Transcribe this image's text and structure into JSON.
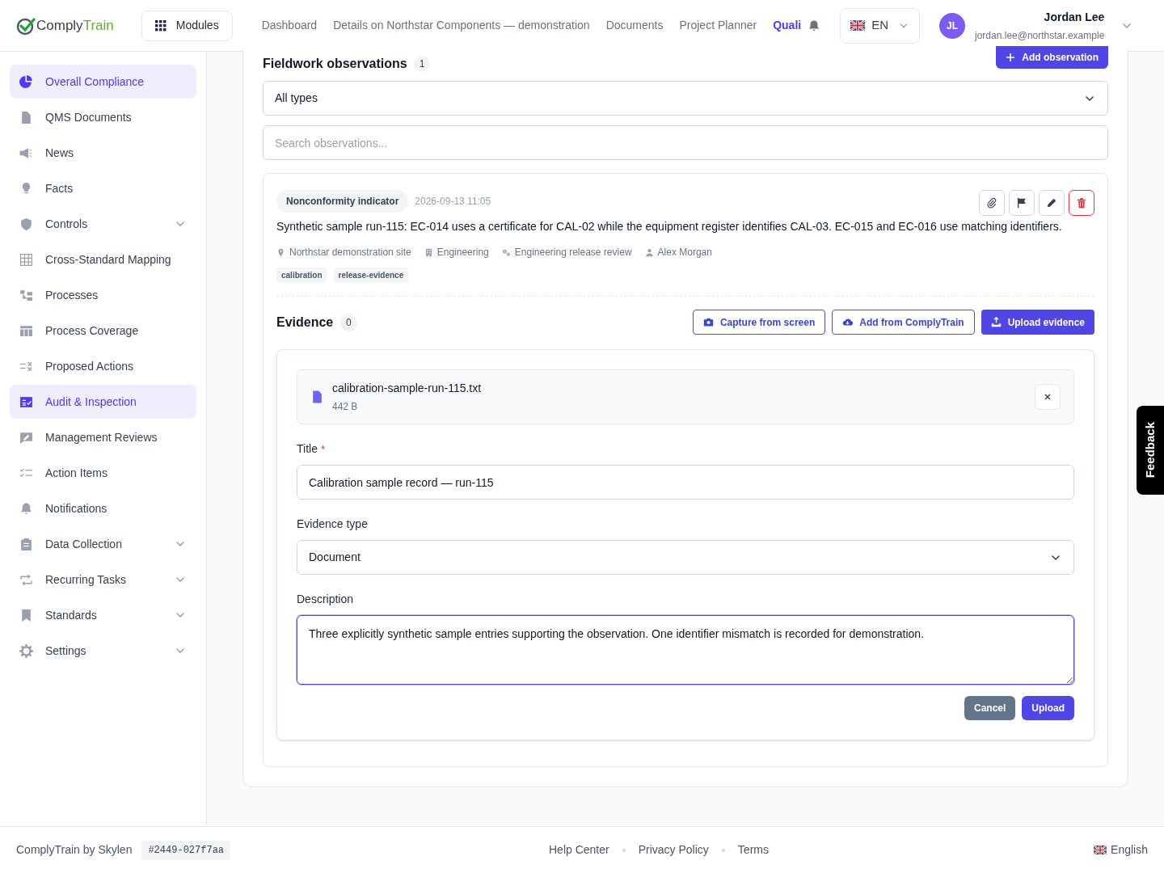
{
  "header": {
    "logo": {
      "part1": "Comply",
      "part2": "Train"
    },
    "modules_button": "Modules",
    "nav": [
      {
        "label": "Dashboard",
        "selected": false
      },
      {
        "label": "Details on Northstar Components — demonstration",
        "selected": false
      },
      {
        "label": "Documents",
        "selected": false
      },
      {
        "label": "Project Planner",
        "selected": false
      },
      {
        "label": "Quali",
        "selected": true
      }
    ],
    "language": "EN",
    "user": {
      "initials": "JL",
      "name": "Jordan Lee",
      "email": "jordan.lee@northstar.example"
    }
  },
  "sidebar": {
    "items": [
      {
        "label": "Overall Compliance",
        "selected": true
      },
      {
        "label": "QMS Documents",
        "selected": false
      },
      {
        "label": "News",
        "selected": false
      },
      {
        "label": "Facts",
        "selected": false
      },
      {
        "label": "Controls",
        "selected": false,
        "expanded": false
      },
      {
        "label": "Cross-Standard Mapping",
        "selected": false
      },
      {
        "label": "Processes",
        "selected": false
      },
      {
        "label": "Process Coverage",
        "selected": false
      },
      {
        "label": "Proposed Actions",
        "selected": false
      },
      {
        "label": "Audit & Inspection",
        "selected": true
      },
      {
        "label": "Management Reviews",
        "selected": false
      },
      {
        "label": "Action Items",
        "selected": false
      },
      {
        "label": "Notifications",
        "selected": false
      },
      {
        "label": "Data Collection",
        "selected": false,
        "expanded": false
      },
      {
        "label": "Recurring Tasks",
        "selected": false,
        "expanded": false
      },
      {
        "label": "Standards",
        "selected": false,
        "expanded": false
      },
      {
        "label": "Settings",
        "selected": false,
        "expanded": false
      }
    ]
  },
  "observations": {
    "title": "Fieldwork observations",
    "count": "1",
    "add_button": "Add observation",
    "type_filter": "All types",
    "search": {
      "placeholder": "Search observations..."
    },
    "items": [
      {
        "type": "Nonconformity indicator",
        "timestamp": "2026-09-13 11:05",
        "text": "Synthetic sample run-115: EC-014 uses a certificate for CAL-02 while the equipment register identifies CAL-03. EC-015 and EC-016 use matching identifiers.",
        "meta": [
          {
            "kind": "location",
            "text": "Northstar demonstration site"
          },
          {
            "kind": "department",
            "text": "Engineering"
          },
          {
            "kind": "process",
            "text": "Engineering release review"
          },
          {
            "kind": "person",
            "text": "Alex Morgan"
          }
        ],
        "tags": [
          "calibration",
          "release-evidence"
        ],
        "evidence": {
          "title": "Evidence",
          "count": "0",
          "buttons": [
            {
              "label": "Capture from screen",
              "kind": "capture"
            },
            {
              "label": "Add from ComplyTrain",
              "kind": "library"
            },
            {
              "label": "Upload evidence",
              "kind": "upload"
            }
          ],
          "file": {
            "name": "calibration-sample-run-115.txt",
            "size": "442 B"
          },
          "fields": [
            {
              "kind": "text",
              "label": "Title",
              "required_mark": "*",
              "value": "Calibration sample record — run-115",
              "focused": false
            },
            {
              "kind": "select",
              "label": "Evidence type",
              "value": "Document",
              "focused": false
            },
            {
              "kind": "textarea",
              "label": "Description",
              "value": "Three explicitly synthetic sample entries supporting the observation. One identifier mismatch is recorded for demonstration.",
              "focused": true
            }
          ],
          "cancel": "Cancel",
          "submit": "Upload"
        }
      }
    ]
  },
  "feedback": "Feedback",
  "footer": {
    "brand": "ComplyTrain by Skylen",
    "build": "#2449-027f7aa",
    "links": [
      "Help Center",
      "Privacy Policy",
      "Terms"
    ],
    "language": "English"
  }
}
